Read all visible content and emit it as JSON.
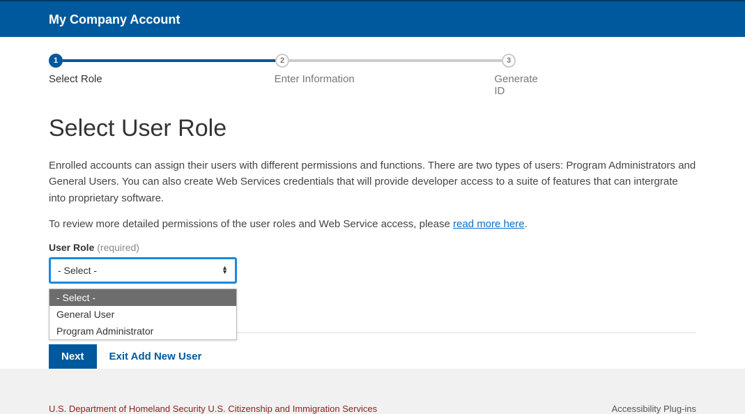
{
  "header": {
    "title": "My Company Account"
  },
  "stepper": {
    "steps": [
      {
        "num": "1",
        "label": "Select Role"
      },
      {
        "num": "2",
        "label": "Enter Information"
      },
      {
        "num": "3",
        "label": "Generate ID"
      }
    ]
  },
  "page": {
    "title": "Select User Role",
    "desc1": "Enrolled accounts can assign their users with different permissions and functions. There are two types of users: Program Administrators and General Users. You can also create Web Services credentials that will provide developer access to a suite of features that can intergrate into proprietary software.",
    "desc2_prefix": "To review more detailed permissions of the user roles and Web Service access, please ",
    "desc2_link": "read more here",
    "desc2_suffix": "."
  },
  "form": {
    "role_label": "User Role",
    "role_required": "(required)",
    "role_value": "- Select -",
    "role_options": [
      "- Select -",
      "General User",
      "Program Administrator"
    ]
  },
  "actions": {
    "next": "Next",
    "exit": "Exit Add New User"
  },
  "footer": {
    "left": "U.S. Department of Homeland Security   U.S. Citizenship and Immigration Services",
    "right": "Accessibility   Plug-ins"
  }
}
